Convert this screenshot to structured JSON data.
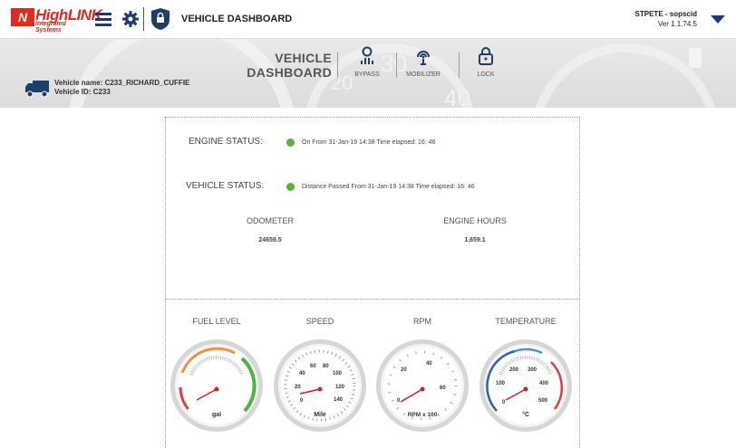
{
  "header": {
    "logo_brand": "HighLINK",
    "logo_mark": "N",
    "logo_tagline": "Integrated Systems",
    "title": "VEHICLE DASHBOARD",
    "user": "STPETE - sopscid",
    "version": "Ver 1.1.74.5",
    "icons": {
      "menu": "hamburger-icon",
      "settings": "gear-icon",
      "app": "shield-lock-icon",
      "account": "caret-down-icon"
    }
  },
  "banner": {
    "title_line1": "VEHICLE",
    "title_line2": "DASHBOARD",
    "vehicle_name": "Vehicle name: C233_RICHARD_CUFFIE",
    "vehicle_id": "Vehicle ID: C233",
    "actions": [
      {
        "label": "BYPASS",
        "icon": "bypass-icon"
      },
      {
        "label": "MOBILIZER",
        "icon": "mobilizer-icon"
      },
      {
        "label": "LOCK",
        "icon": "lock-icon"
      }
    ],
    "bg_marks": [
      "20",
      "30",
      "40"
    ]
  },
  "status": {
    "engine_label": "ENGINE STATUS:",
    "engine_text": "On From 31-Jan-19 14:38 Time elapsed: 16: 46",
    "vehicle_label": "VEHICLE STATUS:",
    "vehicle_text": "Distance Passed From 31-Jan-19 14:38 Time elapsed: 16: 46",
    "status_color": "#5cb23c"
  },
  "metrics": {
    "odometer_label": "ODOMETER",
    "odometer_value": "24659.5",
    "hours_label": "ENGINE HOURS",
    "hours_value": "1,659.1"
  },
  "gauges": {
    "fuel": {
      "label": "FUEL LEVEL",
      "unit": "gal"
    },
    "speed": {
      "label": "SPEED",
      "unit": "Mile",
      "ticks": [
        "0",
        "20",
        "40",
        "60",
        "80",
        "100",
        "120",
        "140"
      ]
    },
    "rpm": {
      "label": "RPM",
      "unit": "RPM x 100",
      "ticks": [
        "0",
        "20",
        "40",
        "60"
      ]
    },
    "temp": {
      "label": "TEMPERATURE",
      "unit": "°C",
      "ticks": [
        "0",
        "100",
        "200",
        "300",
        "400",
        "500"
      ]
    }
  }
}
